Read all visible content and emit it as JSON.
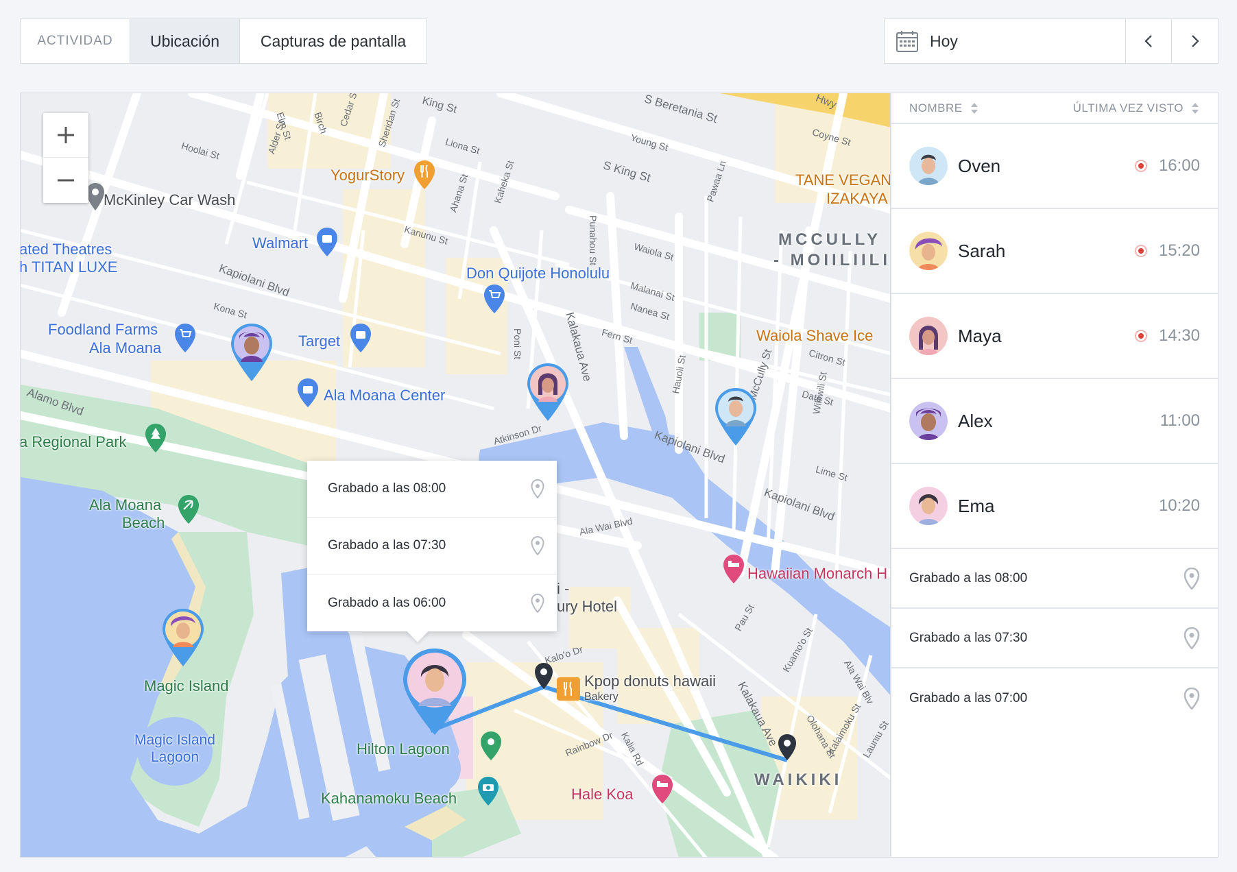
{
  "tabs": [
    {
      "label": "ACTIVIDAD"
    },
    {
      "label": "Ubicación"
    },
    {
      "label": "Capturas de pantalla"
    }
  ],
  "date": {
    "label": "Hoy",
    "icon": "calendar-icon",
    "prev_icon": "chevron-left-icon",
    "next_icon": "chevron-right-icon"
  },
  "map": {
    "zoom_in": "+",
    "zoom_out": "−",
    "places": [
      "McKinley Car Wash",
      "YogurStory",
      "Walmart",
      "ated Theatres",
      "h TITAN LUXE",
      "Don Quijote Honolulu",
      "TANE VEGAN",
      "IZAKAYA",
      "MCCULLY",
      "- MOIILIILI",
      "Foodland Farms",
      "Ala Moana",
      "Target",
      "Waiola Shave Ice",
      "Ala Moana Center",
      "a Regional Park",
      "Ala Moana",
      "Beach",
      "Hawaiian Monarch H",
      "i -",
      "ury Hotel",
      "Magic Island",
      "Kpop donuts hawaii",
      "Bakery",
      "Magic Island",
      "Lagoon",
      "Hilton Lagoon",
      "Kahanamoku Beach",
      "Hale Koa",
      "WAIKIKI"
    ],
    "streets": [
      "Elm St",
      "Birch",
      "Cedar St",
      "Sheridan St",
      "King St",
      "S Beretania St",
      "Hwy",
      "Hoolai St",
      "Alder St",
      "Liona St",
      "Young St",
      "Coyne St",
      "S King St",
      "Pawaa Ln",
      "Ahana St",
      "Kaheka St",
      "Punahou St",
      "Kanunu St",
      "Waiola St",
      "Kapiolani Blvd",
      "Kona St",
      "Malanai St",
      "Nanea St",
      "Fern St",
      "Citron St",
      "Poni St",
      "Kalakaua Ave",
      "Date St",
      "Alamo Blvd",
      "Hauoli St",
      "McCully St",
      "Williwili St",
      "Atkinson Dr",
      "Kapiolani Blvd",
      "Lime St",
      "Kapiolani Blvd",
      "Ala Wai Blvd",
      "Kalo'o Dr",
      "Pau St",
      "Kuamo'o St",
      "Ala Wai Blv",
      "Olohana St",
      "Kalakaua Ave",
      "Rainbow Dr",
      "Kalia Rd",
      "Kalaimoku St",
      "Launiu St"
    ],
    "popup": [
      {
        "label": "Grabado a las 08:00"
      },
      {
        "label": "Grabado a las 07:30"
      },
      {
        "label": "Grabado a las 06:00"
      }
    ]
  },
  "panel": {
    "col_name": "NOMBRE",
    "col_last_seen": "ÚLTIMA VEZ VISTO",
    "users": [
      {
        "name": "Oven",
        "time": "16:00",
        "live": true
      },
      {
        "name": "Sarah",
        "time": "15:20",
        "live": true
      },
      {
        "name": "Maya",
        "time": "14:30",
        "live": true
      },
      {
        "name": "Alex",
        "time": "11:00",
        "live": false
      },
      {
        "name": "Ema",
        "time": "10:20",
        "live": false
      }
    ],
    "records": [
      {
        "label": "Grabado a las 08:00"
      },
      {
        "label": "Grabado a las 07:30"
      },
      {
        "label": "Grabado a las 07:00"
      }
    ]
  },
  "colors": {
    "accent": "#4a9be8",
    "live": "#e0403a",
    "water": "#a9c4f5",
    "park": "#c7e6cf"
  }
}
